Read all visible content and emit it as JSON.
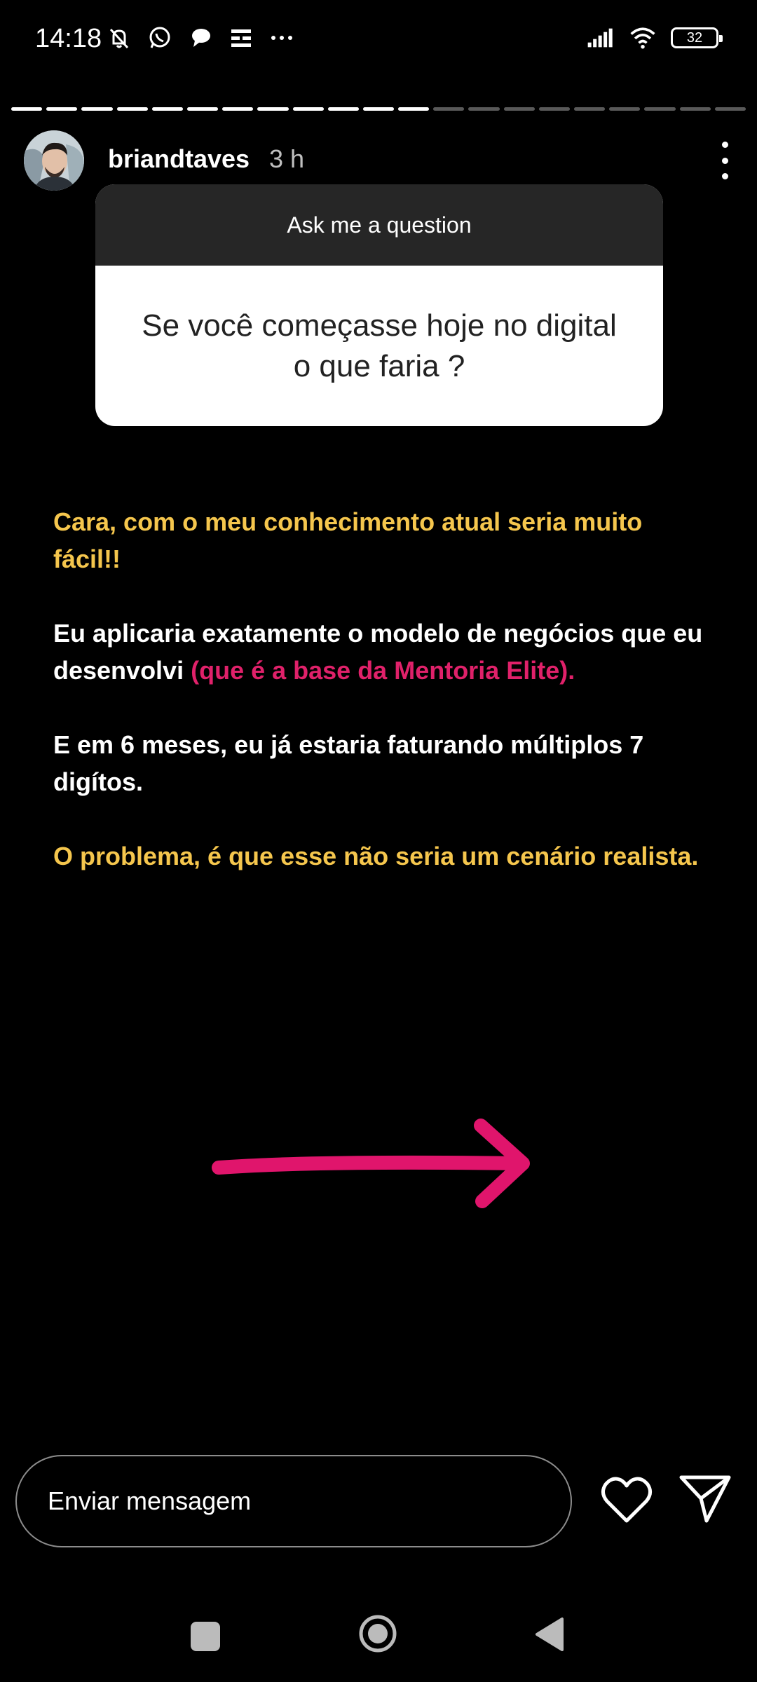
{
  "status_bar": {
    "time": "14:18",
    "battery": "32",
    "icons": [
      "mute-icon",
      "whatsapp-icon",
      "message-icon",
      "menu-icon",
      "more-dots-icon",
      "signal-icon",
      "wifi-icon",
      "battery-icon"
    ]
  },
  "story": {
    "progress": {
      "total_segments": 21,
      "completed_segments": 12
    },
    "username": "briandtaves",
    "time_ago": "3 h",
    "question_sticker": {
      "header": "Ask me a question",
      "question": "Se você começasse hoje no digital o que faria ?"
    },
    "paragraphs": [
      {
        "segments": [
          {
            "text": "Cara, com o meu conhecimento atual seria muito fácil!!",
            "color": "yellow"
          }
        ]
      },
      {
        "segments": [
          {
            "text": "Eu aplicaria exatamente o modelo de negócios que eu desenvolvi ",
            "color": "white"
          },
          {
            "text": "(que é a base da Mentoria Elite).",
            "color": "pink"
          }
        ]
      },
      {
        "segments": [
          {
            "text": "E em 6 meses, eu já estaria faturando múltiplos 7 digítos.",
            "color": "white"
          }
        ]
      },
      {
        "segments": [
          {
            "text": "O problema, é que esse não seria um cenário realista.",
            "color": "yellow"
          }
        ]
      }
    ],
    "arrow_color": "#e0156c"
  },
  "composer": {
    "placeholder": "Enviar mensagem"
  },
  "colors": {
    "yellow": "#f5c64d",
    "pink": "#e0216a",
    "sticker_header": "#262626"
  }
}
